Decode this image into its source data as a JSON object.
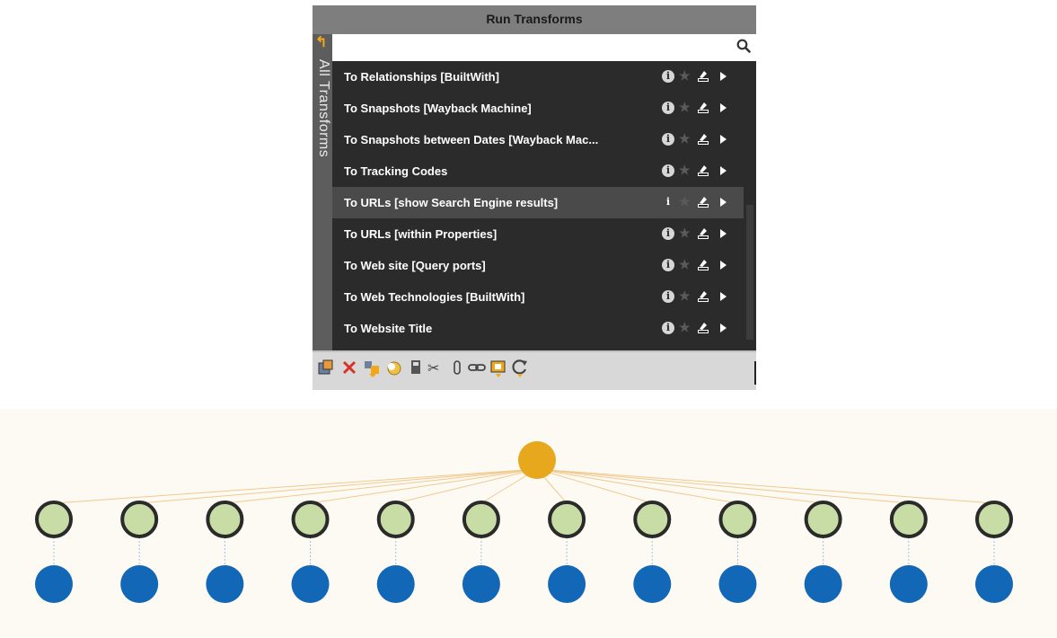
{
  "panel": {
    "title": "Run Transforms",
    "side_tab_label": "All Transforms",
    "search": {
      "value": "",
      "placeholder": ""
    },
    "items": [
      {
        "label": "To Relationships [BuiltWith]",
        "selected": false
      },
      {
        "label": "To Snapshots [Wayback Machine]",
        "selected": false
      },
      {
        "label": "To Snapshots between Dates [Wayback Mac...",
        "selected": false
      },
      {
        "label": "To Tracking Codes",
        "selected": false
      },
      {
        "label": "To URLs [show Search Engine results]",
        "selected": true
      },
      {
        "label": "To URLs [within Properties]",
        "selected": false
      },
      {
        "label": "To Web site [Query ports]",
        "selected": false
      },
      {
        "label": "To Web Technologies [BuiltWith]",
        "selected": false
      },
      {
        "label": "To Website Title",
        "selected": false
      }
    ],
    "row_icons": [
      "info-icon",
      "star-icon",
      "settings-icon",
      "run-arrow-icon"
    ],
    "toolbar_icons": [
      "export-icon",
      "delete-icon",
      "merge-icon",
      "toggle-icon",
      "paste-icon",
      "cut-icon",
      "attach-icon",
      "link-icon",
      "select-icon",
      "refresh-icon"
    ]
  },
  "graph": {
    "root": {
      "color": "#E8A81E"
    },
    "child_count": 12,
    "child_color": "#C7DDA5",
    "child_border": "#2a2a2a",
    "leaf_color": "#1267B6",
    "edge_color": "#F2C98F"
  },
  "colors": {
    "panel_bg": "#2b2b2b",
    "title_bar": "#7e7e7e",
    "accent_orange": "#F0A81A",
    "delete_red": "#D9312A"
  }
}
